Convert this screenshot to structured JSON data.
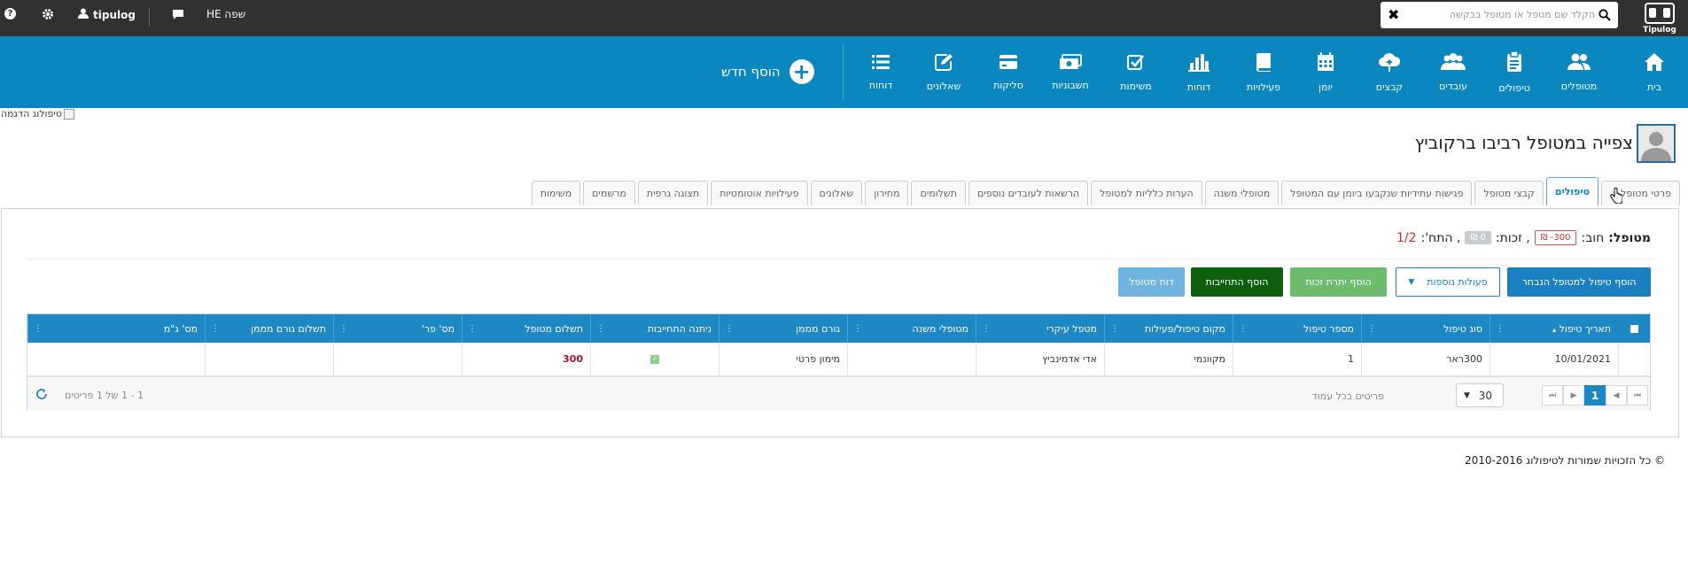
{
  "topbar": {
    "logo_text": "Tipulog",
    "search_placeholder": "הקלד שם מטפל או מטופל בבקשה",
    "user_name": "tipulog",
    "language_label": "שפה HE"
  },
  "nav": {
    "items": [
      {
        "label": "בית",
        "icon": "home-icon"
      },
      {
        "label": "מטופלים",
        "icon": "users-icon"
      },
      {
        "label": "טיפולים",
        "icon": "clipboard-icon"
      },
      {
        "label": "עובדים",
        "icon": "group-icon"
      },
      {
        "label": "קבצים",
        "icon": "cloud-upload-icon"
      },
      {
        "label": "יומן",
        "icon": "calendar-icon"
      },
      {
        "label": "פעילויות",
        "icon": "book-icon"
      },
      {
        "label": "דוחות",
        "icon": "bar-chart-icon"
      },
      {
        "label": "משימות",
        "icon": "check-square-icon"
      },
      {
        "label": "חשבוניות",
        "icon": "money-icon"
      },
      {
        "label": "סליקות",
        "icon": "credit-card-icon"
      },
      {
        "label": "שאלונים",
        "icon": "edit-icon"
      },
      {
        "label": "דוחות",
        "icon": "list-icon"
      }
    ],
    "add_new_label": "הוסף חדש"
  },
  "page": {
    "demo_image_alt": "טיפולוג הדגמה",
    "title": "צפייה במטופל רביבו ברקוביץ"
  },
  "tabs": [
    {
      "label": "פרטי מטופל",
      "active": false
    },
    {
      "label": "טיפולים",
      "active": true
    },
    {
      "label": "קבצי מטופל",
      "active": false
    },
    {
      "label": "פגישות עתידיות שנקבעו ביומן עם המטופל",
      "active": false
    },
    {
      "label": "מטופלי משנה",
      "active": false
    },
    {
      "label": "הערות כלליות למטופל",
      "active": false
    },
    {
      "label": "הרשאות לעובדים נוספים",
      "active": false
    },
    {
      "label": "תשלומים",
      "active": false
    },
    {
      "label": "מחירון",
      "active": false
    },
    {
      "label": "שאלונים",
      "active": false
    },
    {
      "label": "פעילויות אוטומטיות",
      "active": false
    },
    {
      "label": "תצוגה גרפית",
      "active": false
    },
    {
      "label": "מרשמים",
      "active": false
    },
    {
      "label": "משימות",
      "active": false
    }
  ],
  "summary": {
    "label": "מטופל:",
    "debt_label": "חוב:",
    "debt_value": "300- ₪",
    "credit_label": ", זכות:",
    "credit_value": "0 ₪",
    "commitments_label": ", התח':",
    "commitments_value": "1/2"
  },
  "actions": {
    "add_treatment": "הוסף טיפול למטופל הנבחר",
    "more_actions": "פעולות נוספות",
    "add_credit": "הוסף יתרת זכות",
    "add_commitment": "הוסף התחייבות",
    "patient_report": "דוח מטופל"
  },
  "table": {
    "columns": [
      "תאריך טיפול",
      "סוג טיפול",
      "מספר טיפול",
      "מקום טיפול/פעילות",
      "מטפל עיקרי",
      "מטופלי משנה",
      "גורם מממן",
      "ניתנה התחייבות",
      "תשלום מטופל",
      "מס' פר'",
      "תשלום גורם מממן",
      "מס' ג\"מ"
    ],
    "rows": [
      {
        "date": "10/01/2021",
        "type": "300ראר",
        "number": "1",
        "location": "מקוונמי",
        "therapist": "אדי אדמינביץ",
        "sub_patients": "",
        "funder": "מימון פרטי",
        "commitment": true,
        "patient_payment": "300",
        "receipt_no": "",
        "funder_payment": "",
        "funder_no": ""
      }
    ]
  },
  "pager": {
    "current_page": "1",
    "page_size": "30",
    "page_size_label": "פריטים בכל עמוד",
    "range_text": "1 - 1 של 1 פריטים"
  },
  "footer": {
    "copyright": "© כל הזכויות שמורות לטיפולוג 2010-2016"
  },
  "colors": {
    "topbar": "#313131",
    "nav": "#0b87bf",
    "grid_header": "#1e88c4",
    "btn_primary": "#1b80c2",
    "btn_success_light": "#6dbb6d",
    "btn_success_dark": "#0d5e0d",
    "btn_info_light": "#6fb3e0",
    "debt_red": "#c9302c"
  }
}
